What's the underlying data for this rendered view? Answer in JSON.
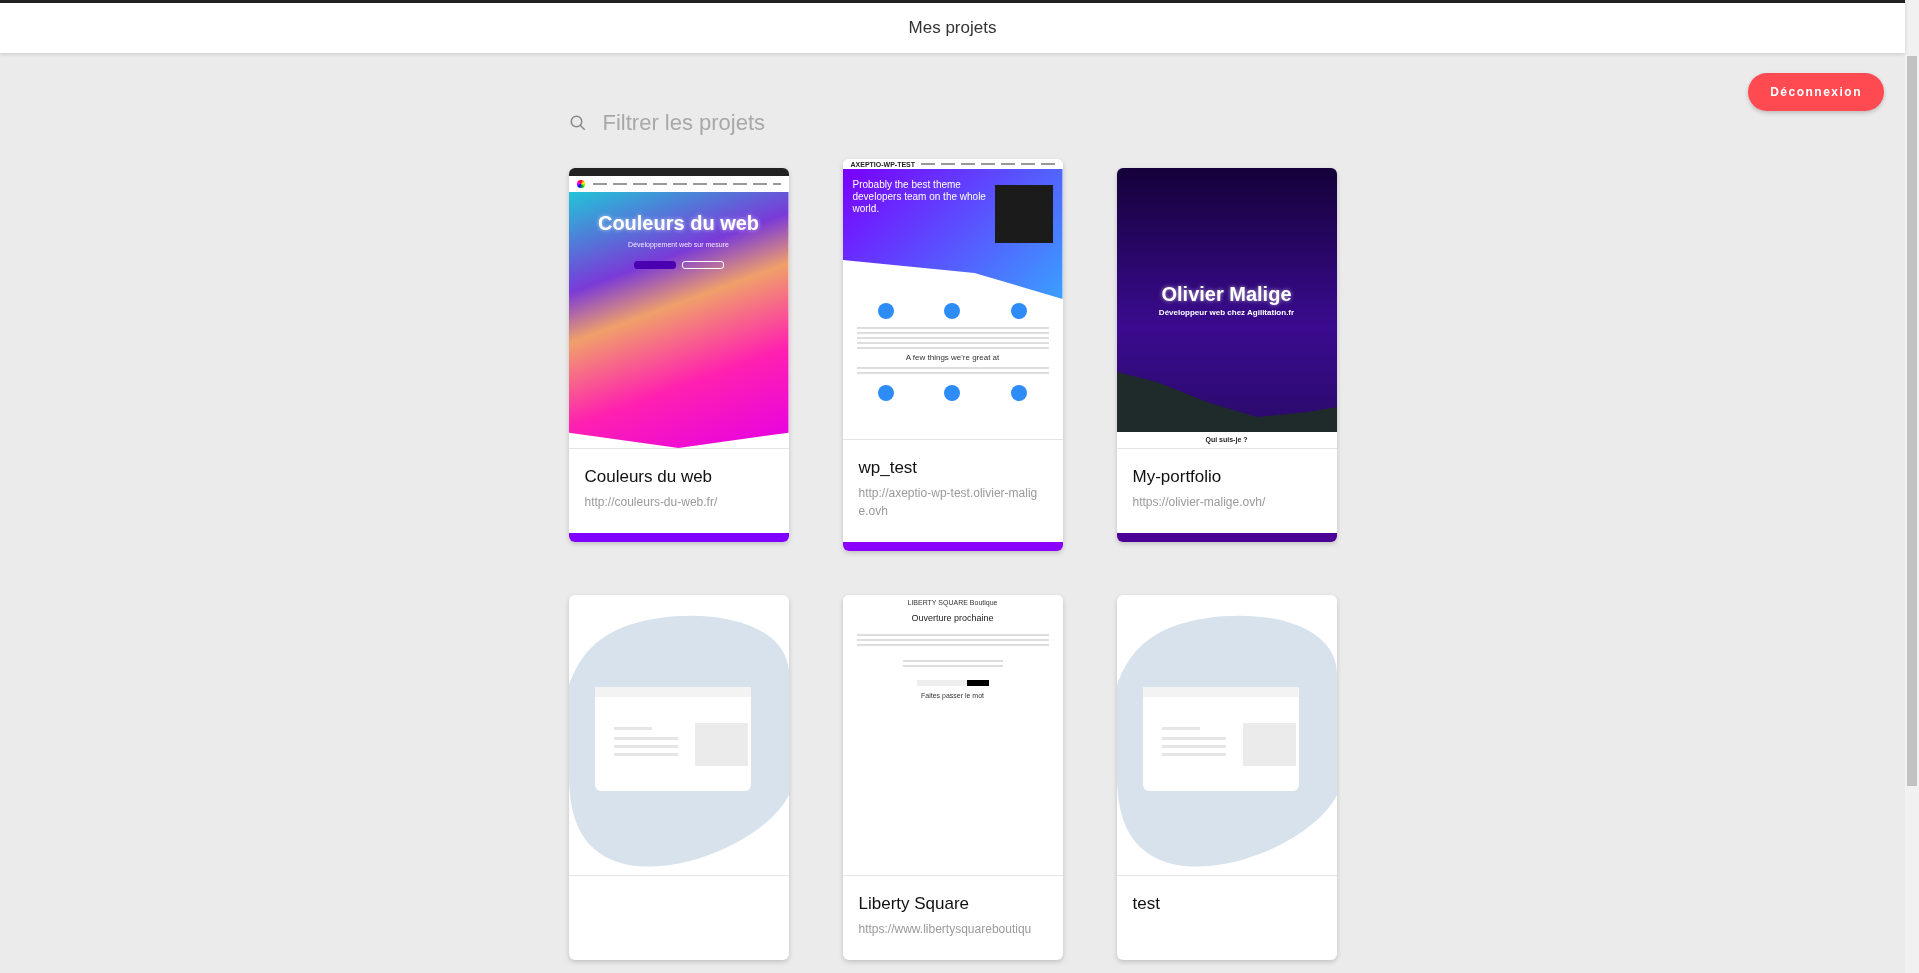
{
  "header": {
    "title": "Mes projets"
  },
  "logout_button": {
    "label": "Déconnexion"
  },
  "search": {
    "placeholder": "Filtrer les projets"
  },
  "projects": [
    {
      "name": "Couleurs du web",
      "url": "http://couleurs-du-web.fr/",
      "color": "#8000ff",
      "thumbnail": {
        "kind": "hero",
        "headline": "Couleurs du web",
        "subtitle": "Développement web sur mesure"
      }
    },
    {
      "name": "wp_test",
      "url": "http://axeptio-wp-test.olivier-malige.ovh",
      "color": "#8a00ff",
      "thumbnail": {
        "kind": "theme",
        "brand": "AXEPTIO-WP-TEST",
        "headline": "Probably the best theme developers team on the whole world.",
        "section_title": "A few things we're great at"
      }
    },
    {
      "name": "My-portfolio",
      "url": "https://olivier-malige.ovh/",
      "color": "#4b0096",
      "thumbnail": {
        "kind": "night",
        "headline": "Olivier Malige",
        "subtitle": "Développeur web chez Agilitation.fr",
        "section_title": "Qui suis-je ?"
      }
    },
    {
      "thumbnail": {
        "kind": "placeholder"
      }
    },
    {
      "name": "Liberty Square",
      "url": "https://www.libertysquareboutiqu",
      "thumbnail": {
        "kind": "shop",
        "brand": "LIBERTY SQUARE Boutique",
        "headline": "Ouverture prochaine",
        "section_title": "Faites passer le mot"
      }
    },
    {
      "name": "test",
      "thumbnail": {
        "kind": "placeholder"
      }
    }
  ]
}
